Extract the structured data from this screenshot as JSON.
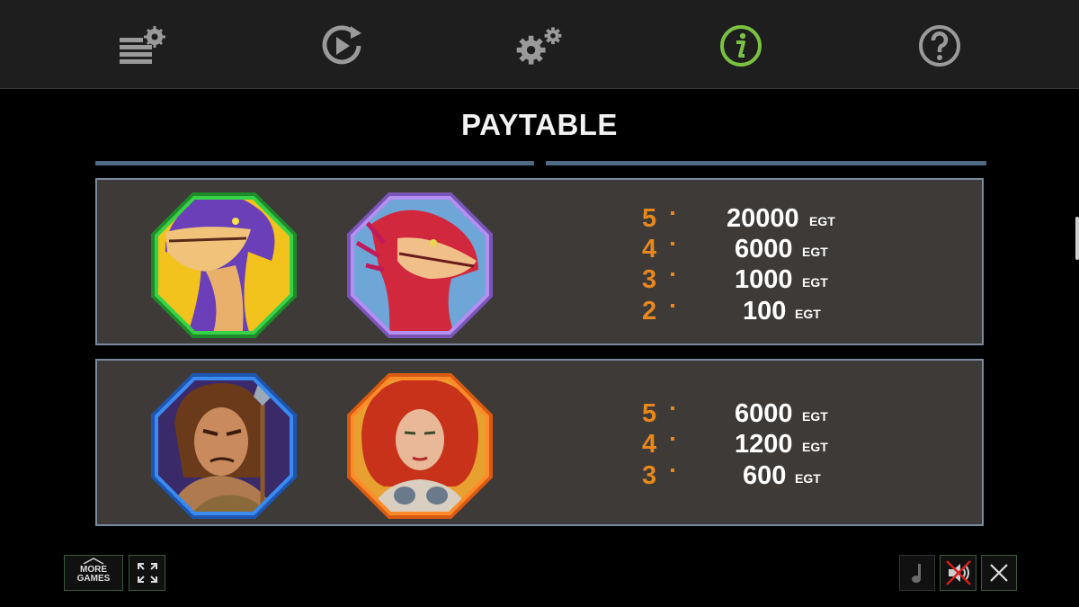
{
  "nav": {
    "items": [
      {
        "name": "bet-settings",
        "icon": "bet-settings-icon"
      },
      {
        "name": "autoplay",
        "icon": "replay-icon"
      },
      {
        "name": "settings",
        "icon": "gear-icon"
      },
      {
        "name": "info",
        "icon": "info-icon",
        "active": true
      },
      {
        "name": "help",
        "icon": "help-icon"
      }
    ],
    "active_color": "#7ac142",
    "icon_color": "#9a9a9a"
  },
  "title": "PAYTABLE",
  "panels": [
    {
      "symbols": [
        {
          "name": "purple-dinosaur",
          "frame_color": "#2fb83a"
        },
        {
          "name": "red-dragon",
          "frame_color": "#9a6fd6"
        }
      ],
      "pays": [
        {
          "count": "5",
          "value": "20000",
          "unit": "EGT"
        },
        {
          "count": "4",
          "value": "6000",
          "unit": "EGT"
        },
        {
          "count": "3",
          "value": "1000",
          "unit": "EGT"
        },
        {
          "count": "2",
          "value": "100",
          "unit": "EGT"
        }
      ]
    },
    {
      "symbols": [
        {
          "name": "caveman",
          "frame_color": "#2f6fd0"
        },
        {
          "name": "cavewoman",
          "frame_color": "#f07020"
        }
      ],
      "pays": [
        {
          "count": "5",
          "value": "6000",
          "unit": "EGT"
        },
        {
          "count": "4",
          "value": "1200",
          "unit": "EGT"
        },
        {
          "count": "3",
          "value": "600",
          "unit": "EGT"
        }
      ]
    }
  ],
  "bottom": {
    "more_games_line1": "MORE",
    "more_games_line2": "GAMES"
  }
}
